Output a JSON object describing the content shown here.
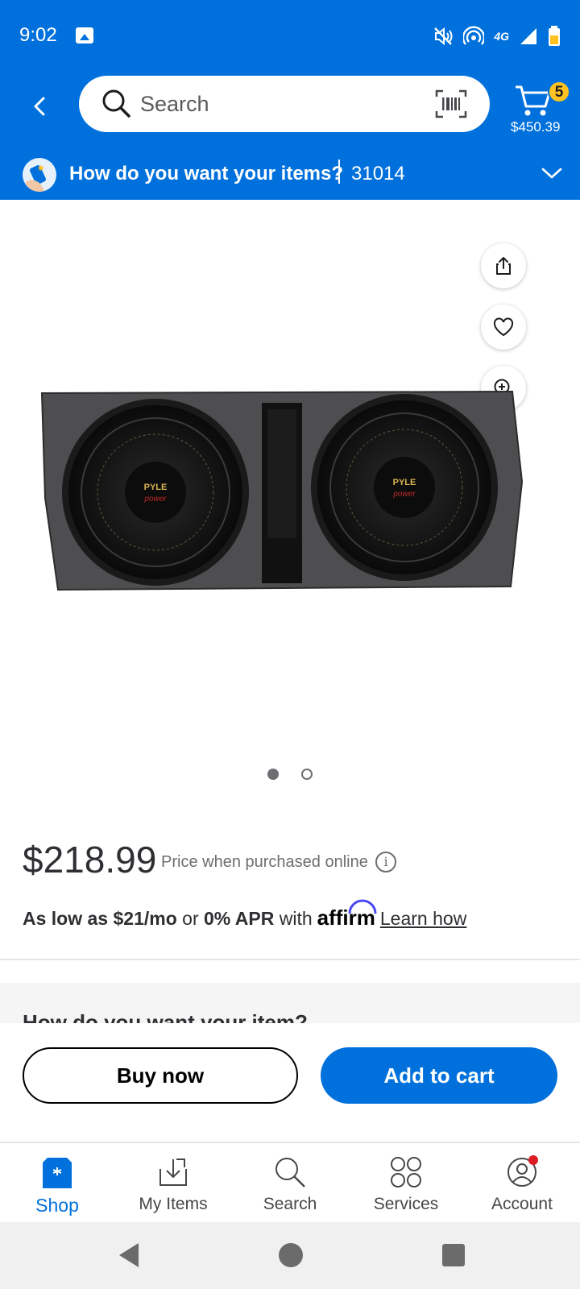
{
  "status_bar": {
    "time": "9:02",
    "icons": [
      "gallery-icon",
      "mute-icon",
      "hotspot-icon",
      "4g-lte-icon",
      "signal-icon",
      "battery-icon"
    ],
    "network_label": "4G"
  },
  "header": {
    "search": {
      "placeholder": "Search"
    },
    "cart": {
      "count": "5",
      "total": "$450.39"
    },
    "delivery": {
      "question": "How do you want your items?",
      "zip": "31014"
    }
  },
  "product": {
    "image_alt": "Pyle Power dual subwoofer enclosure",
    "image_count": 2,
    "active_image": 1,
    "price": "$218.99",
    "price_note": "Price when purchased online",
    "financing": {
      "prefix": "As low as",
      "monthly": "$21/mo",
      "or": "or",
      "apr": "0% APR",
      "with": "with",
      "provider": "affirm",
      "link": "Learn how"
    },
    "next_section_peek": "How do you want your item?"
  },
  "actions": {
    "buy_now": "Buy now",
    "add_to_cart": "Add to cart"
  },
  "bottom_nav": {
    "items": [
      {
        "label": "Shop",
        "icon": "shop-icon",
        "active": true
      },
      {
        "label": "My Items",
        "icon": "my-items-icon",
        "active": false
      },
      {
        "label": "Search",
        "icon": "search-icon",
        "active": false
      },
      {
        "label": "Services",
        "icon": "services-icon",
        "active": false
      },
      {
        "label": "Account",
        "icon": "account-icon",
        "active": false,
        "notification": true
      }
    ]
  },
  "colors": {
    "brand_blue": "#0071dc",
    "badge_yellow": "#ffc220",
    "notification_red": "#de1c24"
  }
}
